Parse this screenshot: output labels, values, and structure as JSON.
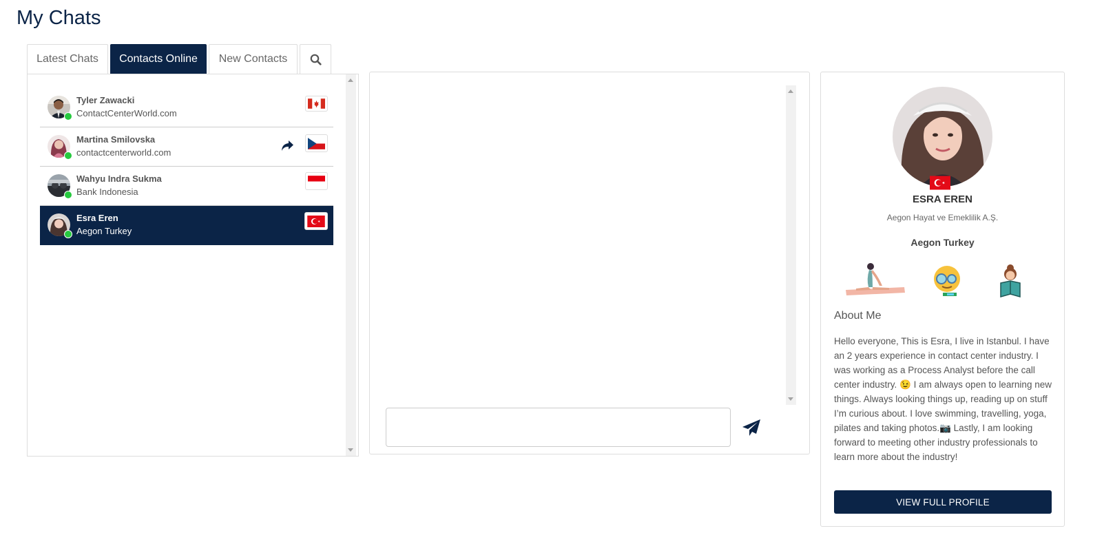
{
  "page": {
    "title": "My Chats"
  },
  "tabs": [
    {
      "label": "Latest Chats"
    },
    {
      "label": "Contacts Online"
    },
    {
      "label": "New Contacts"
    }
  ],
  "search_icon": "search-icon",
  "colors": {
    "brand_navy": "#0b2447",
    "online_green": "#27c93f"
  },
  "contacts": [
    {
      "name": "Tyler Zawacki",
      "org": "ContactCenterWorld.com",
      "flag": "canada-flag-icon",
      "online": true
    },
    {
      "name": "Martina Smilovska",
      "org": "contactcenterworld.com",
      "flag": "czech-flag-icon",
      "online": true,
      "action_icon": "forward-arrow-icon"
    },
    {
      "name": "Wahyu Indra Sukma",
      "org": "Bank Indonesia",
      "flag": "indonesia-flag-icon",
      "online": true
    },
    {
      "name": "Esra Eren",
      "org": "Aegon Turkey",
      "flag": "turkey-flag-icon",
      "online": true,
      "selected": true
    }
  ],
  "chat": {
    "message_value": "",
    "send_icon": "paper-plane-icon"
  },
  "profile": {
    "name": "ESRA EREN",
    "company": "Aegon Hayat ve Emeklilik A.Ş.",
    "organization": "Aegon Turkey",
    "flag": "turkey-flag-icon",
    "hobbies": [
      "yoga-icon",
      "swimming-icon",
      "reading-icon"
    ],
    "about_heading": "About Me",
    "about_text": "Hello everyone, This is Esra, I live in Istanbul. I have an 2 years experience in contact center industry. I was working as a Process Analyst before the call center industry. 😉 I am always open to learning new things. Always looking things up, reading up on stuff I’m curious about. I love swimming, travelling, yoga, pilates and taking photos.📷 Lastly, I am looking forward to meeting other industry professionals to learn more about the industry!",
    "view_button": "VIEW FULL PROFILE"
  }
}
